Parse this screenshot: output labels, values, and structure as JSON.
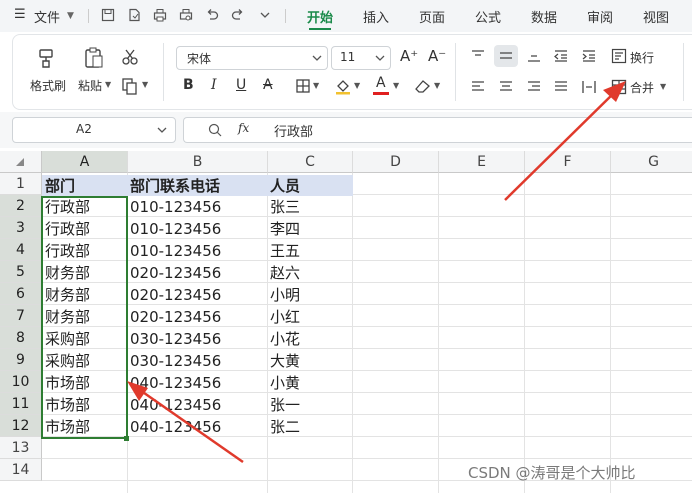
{
  "menubar": {
    "file_label": "文件",
    "tabs": [
      "开始",
      "插入",
      "页面",
      "公式",
      "数据",
      "审阅",
      "视图"
    ],
    "active_tab": "开始"
  },
  "ribbon": {
    "format_painter": "格式刷",
    "paste": "粘贴",
    "font_name": "宋体",
    "font_size": "11",
    "wrap": "换行",
    "merge": "合并"
  },
  "formula_bar": {
    "name_box": "A2",
    "fx": "fx",
    "content": "行政部"
  },
  "sheet": {
    "columns": [
      "A",
      "B",
      "C",
      "D",
      "E",
      "F",
      "G"
    ],
    "rows": [
      "1",
      "2",
      "3",
      "4",
      "5",
      "6",
      "7",
      "8",
      "9",
      "10",
      "11",
      "12",
      "13",
      "14"
    ],
    "headers": [
      "部门",
      "部门联系电话",
      "人员"
    ],
    "data": [
      [
        "行政部",
        "010-123456",
        "张三"
      ],
      [
        "行政部",
        "010-123456",
        "李四"
      ],
      [
        "行政部",
        "010-123456",
        "王五"
      ],
      [
        "财务部",
        "020-123456",
        "赵六"
      ],
      [
        "财务部",
        "020-123456",
        "小明"
      ],
      [
        "财务部",
        "020-123456",
        "小红"
      ],
      [
        "采购部",
        "030-123456",
        "小花"
      ],
      [
        "采购部",
        "030-123456",
        "大黄"
      ],
      [
        "市场部",
        "040-123456",
        "小黄"
      ],
      [
        "市场部",
        "040-123456",
        "张一"
      ],
      [
        "市场部",
        "040-123456",
        "张二"
      ]
    ]
  },
  "watermark": "CSDN @涛哥是个大帅比",
  "colors": {
    "accent": "#1a8a4a",
    "arrow": "#e03a2c",
    "selection": "#2e7d32",
    "header_fill": "#d9e1f2"
  }
}
